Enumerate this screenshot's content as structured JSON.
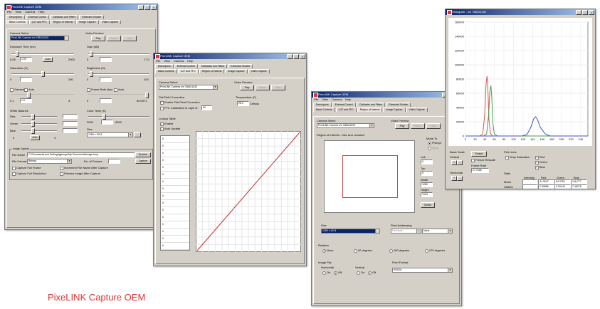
{
  "caption": "PixeLINK Capture OEM",
  "colors": {
    "caption": "#e53030",
    "titlebar": "#0a246a",
    "plot_red": "#e05050",
    "plot_green": "#4a9a4a",
    "plot_blue": "#3a52c8"
  },
  "common": {
    "title": "PixeLINK Capture OEM",
    "menu": [
      "File",
      "View",
      "Camera",
      "Help"
    ],
    "tabs_row1": [
      "Descriptors",
      "External Control",
      "Callbacks and Filters",
      "Extended Shutter"
    ],
    "tabs_row2": [
      "Basic Controls",
      "LUT and FFC",
      "Region of Interest",
      "Image Capture",
      "Video Capture"
    ],
    "camera_select": "Camera Select",
    "camera_value": "PixeLINK Camera s/n 768101020",
    "video_preview": "Video Preview",
    "play": "Play",
    "pause": "Pause",
    "stop": "Stop"
  },
  "win1": {
    "exposure": "Exposure Time (ms)",
    "exposure_val": "1.00",
    "exposure_min": "0.05",
    "exposure_max": "2000",
    "auto": "Auto",
    "gain": "Gain (dB)",
    "gain_min": "0",
    "gain_max": "17.0",
    "saturation": "Saturation (%)",
    "sat_min": "0",
    "sat_max": "200",
    "brightness": "Brightness (%)",
    "br_min": "0",
    "br_max": "100",
    "gamma": "Gamma",
    "gamma_val": "1.0",
    "gamma_min": "0.1",
    "gamma_max": "4",
    "frame_rate": "Frame Rate (fps)",
    "fr_min": "0",
    "fr_max": "80.0971",
    "white_balance": "White Balance",
    "red": "Red",
    "green": "Green",
    "blue": "Blue",
    "wb_min": "0",
    "wb_max": "4",
    "color_temp": "Color Temp (K)",
    "color_temp_min": "3000",
    "color_temp_max": "6500",
    "size": "Size",
    "size_val": "1280 x 1024",
    "image_capture": "Image Capture",
    "file_name": "File Name",
    "file_name_val": "C:\\Documents and Settings\\jgeorge\\My Documents\\image.bmp",
    "browse": "Browse",
    "file_format": "File Format",
    "file_format_val": "Bitmap",
    "frames_to_capture": "No. of Frames",
    "capture": "Capture",
    "opt1": "Capture Full Frame",
    "opt2": "Increment File Name After Capture",
    "opt3": "Capture Full Resolution",
    "opt4": "Preview Image After Capture"
  },
  "win2": {
    "ffc": "Flat Field Correction",
    "enable_ffc": "Enable Flat Field Correction",
    "ffc_calibrate": "FFC Calibration in Light of",
    "ffc_frames": "50",
    "temperature": "Temperature (C)",
    "temp_val": "28.0",
    "temp_unit": "Celsius",
    "lookup": "Lookup Table",
    "enable": "Enable",
    "auto_update": "Auto Update",
    "lut_rows": [
      "0",
      "0",
      "0",
      "0",
      "0",
      "0",
      "0",
      "0",
      "0",
      "0",
      "0",
      "0",
      "0",
      "0",
      "0",
      "0"
    ]
  },
  "win3": {
    "roi": "Region of Interest - Size and Location",
    "mode": "Mode To",
    "mode_opt1": "Prompt",
    "mode_opt2": "Apply",
    "left_lbl": "Left",
    "left_val": "0",
    "top_lbl": "Top",
    "top_val": "0",
    "width_lbl": "Width",
    "width_val": "1280",
    "height_lbl": "Height",
    "height_val": "1024",
    "center": "Center",
    "size": "Size",
    "size_val": "1280 x 1024",
    "pixel_addr": "Pixel Addressing",
    "pixel_addr_val": "Decimate",
    "pixel_mode_val": "None",
    "rotation": "Rotation",
    "rot": [
      "None",
      "90 degrees",
      "180 degrees",
      "270 degrees"
    ],
    "image_flip": "Image Flip",
    "horizontal": "Horizontal",
    "vertical": "Vertical",
    "on": "On",
    "off": "Off",
    "pixel_format": "Pixel Format",
    "pixel_format_val": "RGB24"
  },
  "win4": {
    "title": "Histogram - s/n 768101020",
    "y_ticks": [
      "160000",
      "140000",
      "120000",
      "100000",
      "80000",
      "60000",
      "40000",
      "20000",
      "0"
    ],
    "x_ticks": [
      "0",
      "20",
      "40",
      "60",
      "80",
      "100",
      "120",
      "140",
      "160",
      "180",
      "200",
      "220",
      "240"
    ],
    "basic_scale": "Basic Scale",
    "vertical": "Vertical",
    "horizontal": "Horizontal",
    "freeze": "Freeze",
    "freeze_rescale": "Freeze Rescale",
    "frame_rate": "Frame Rate",
    "frame_rate_val": "27.7026",
    "plot_lines": "Plot Lines",
    "gray_saturation": "Gray Saturation",
    "red": "Red",
    "green": "Green",
    "blue": "Blue",
    "stats": "Stats",
    "stats_cols": [
      "Intensity",
      "Red",
      "Green",
      "Blue"
    ],
    "mean_lbl": "Mean",
    "stddev_lbl": "StdDev",
    "mean_vals": [
      "",
      "44.3047",
      "54.3752",
      "146.777"
    ],
    "std_vals": [
      "",
      "2.99866",
      "3.29145",
      "7.46078"
    ]
  },
  "chart_data": {
    "type": "line",
    "ylim": [
      0,
      160000
    ],
    "xlim": [
      0,
      255
    ],
    "series": [
      {
        "name": "Red",
        "color": "#e05050",
        "x": [
          0,
          30,
          36,
          40,
          43,
          45,
          47,
          49,
          52,
          56,
          255
        ],
        "y": [
          0,
          0,
          3000,
          30000,
          75000,
          84000,
          60000,
          22000,
          4000,
          0,
          0
        ]
      },
      {
        "name": "Green",
        "color": "#4a9a4a",
        "x": [
          0,
          38,
          44,
          48,
          51,
          53,
          55,
          57,
          60,
          66,
          255
        ],
        "y": [
          0,
          0,
          3000,
          28000,
          64000,
          71000,
          52000,
          18000,
          3000,
          0,
          0
        ]
      },
      {
        "name": "Blue",
        "color": "#3a52c8",
        "x": [
          0,
          118,
          128,
          136,
          142,
          146,
          150,
          156,
          166,
          176,
          255
        ],
        "y": [
          0,
          0,
          2000,
          12000,
          24000,
          27000,
          23000,
          12000,
          3000,
          0,
          0
        ]
      }
    ]
  }
}
